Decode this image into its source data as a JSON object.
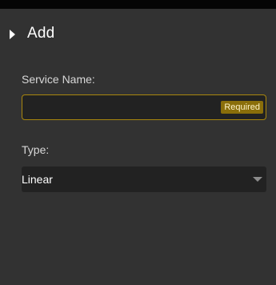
{
  "panel": {
    "section_title": "Add",
    "service_name_label": "Service Name:",
    "service_name_value": "",
    "service_name_placeholder": "",
    "required_badge": "Required",
    "type_label": "Type:",
    "type_selected": "Linear"
  },
  "icons": {
    "section_toggle": "triangle-right-icon",
    "select_caret": "triangle-down-icon"
  },
  "colors": {
    "panel_background": "#323232",
    "input_background": "#222222",
    "required_border": "#a8860e",
    "required_badge_bg": "#8a6e0a"
  }
}
